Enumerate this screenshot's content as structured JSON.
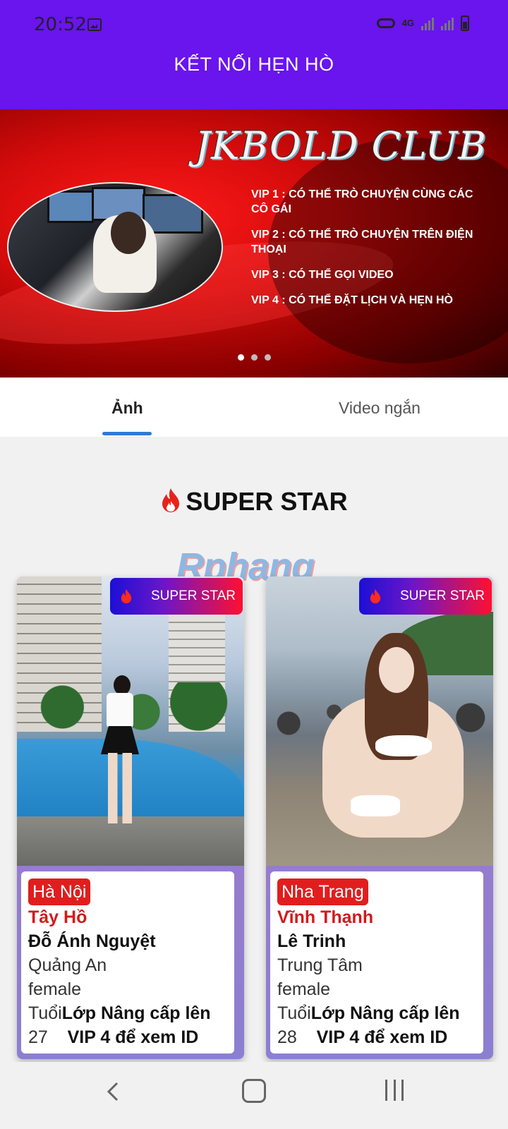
{
  "status_bar": {
    "time": "20:52",
    "network": "4G"
  },
  "header": {
    "title": "KẾT NỐI HẸN HÒ"
  },
  "banner": {
    "club_name": "JKBOLD CLUB",
    "vip_lines": [
      "VIP 1 : CÓ THỂ TRÒ CHUYỆN CÙNG CÁC CÔ GÁI",
      "VIP 2 : CÓ THỂ TRÒ CHUYỆN TRÊN ĐIỆN THOẠI",
      "VIP 3 : CÓ THỂ GỌI VIDEO",
      "VIP 4 : CÓ THỂ ĐẶT LỊCH VÀ HẸN HÒ"
    ]
  },
  "tabs": [
    {
      "label": "Ảnh",
      "active": true
    },
    {
      "label": "Video ngắn",
      "active": false
    }
  ],
  "section": {
    "title": "SUPER STAR",
    "watermark": "Rphang"
  },
  "cards": [
    {
      "badge": "SUPER STAR",
      "city": "Hà Nội",
      "district": "Tây Hồ",
      "name": "Đỗ Ánh Nguyệt",
      "area": "Quảng An",
      "gender": "female",
      "age_label": "Tuổi",
      "upgrade_line1": "Lớp Nâng cấp lên",
      "age": "27",
      "upgrade_line2": "VIP 4 để xem ID"
    },
    {
      "badge": "SUPER STAR",
      "city": "Nha Trang",
      "district": "Vĩnh Thạnh",
      "name": "Lê Trinh",
      "area": "Trung Tâm",
      "gender": "female",
      "age_label": "Tuổi",
      "upgrade_line1": "Lớp Nâng cấp lên",
      "age": "28",
      "upgrade_line2": "VIP 4 để xem ID"
    }
  ],
  "colors": {
    "header": "#6a14ee",
    "accent_red": "#e21d1d",
    "tab_underline": "#2f7ad8"
  },
  "icons": [
    "image-icon",
    "key-icon",
    "signal-icon",
    "battery-icon",
    "flame-icon",
    "back-icon",
    "home-icon",
    "recents-icon"
  ]
}
